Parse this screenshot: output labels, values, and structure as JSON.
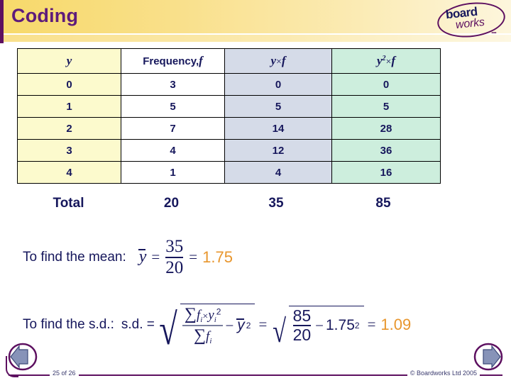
{
  "header": {
    "title": "Coding",
    "logo": {
      "primary": "board",
      "secondary": "works",
      "dots": "..."
    }
  },
  "table": {
    "columns": [
      {
        "key": "y",
        "label_main": "y",
        "label_sup": "",
        "label_op": "",
        "label_tail": ""
      },
      {
        "key": "f",
        "label_main": "Frequency,",
        "label_sup": "",
        "label_op": "",
        "label_tail": "f"
      },
      {
        "key": "yf",
        "label_main": "y",
        "label_sup": "",
        "label_op": "×",
        "label_tail": "f"
      },
      {
        "key": "y2f",
        "label_main": "y",
        "label_sup": "2",
        "label_op": "×",
        "label_tail": "f"
      }
    ],
    "rows": [
      {
        "y": "0",
        "f": "3",
        "yf": "0",
        "y2f": "0"
      },
      {
        "y": "1",
        "f": "5",
        "yf": "5",
        "y2f": "5"
      },
      {
        "y": "2",
        "f": "7",
        "yf": "14",
        "y2f": "28"
      },
      {
        "y": "3",
        "f": "4",
        "yf": "12",
        "y2f": "36"
      },
      {
        "y": "4",
        "f": "1",
        "yf": "4",
        "y2f": "16"
      }
    ],
    "totals": {
      "label": "Total",
      "f": "20",
      "yf": "35",
      "y2f": "85"
    },
    "colors": {
      "col_y": "#fcfacd",
      "col_f": "#ffffff",
      "col_yf": "#d5dbe8",
      "col_y2f": "#cdeedd",
      "text": "#16175c"
    }
  },
  "mean": {
    "prompt": "To find the mean:",
    "symbol": "y",
    "equals1": "=",
    "numerator": "35",
    "denominator": "20",
    "equals2": "=",
    "result": "1.75"
  },
  "sd": {
    "prompt": "To find the s.d.:",
    "label": "s.d. =",
    "sum_symbol": "∑",
    "num_f": "f",
    "num_sub": "i",
    "times": "×",
    "num_y": "y",
    "num_y_sub": "i",
    "num_y_sup": "2",
    "den_f": "f",
    "den_sub": "i",
    "minus": "−",
    "ybar": "y",
    "ybar_sup": "2",
    "equals1": "=",
    "numerator": "85",
    "denominator": "20",
    "minus2": "−",
    "mean_val": "1.75",
    "mean_sup": "2",
    "equals2": "=",
    "result": "1.09"
  },
  "footer": {
    "page": "25 of 26",
    "copyright": "© Boardworks Ltd 2005",
    "prev_label": "previous slide",
    "next_label": "next slide"
  },
  "accent": {
    "purple": "#5d1060",
    "title_purple": "#5e1b7b",
    "orange": "#e8962d",
    "navy": "#16175c"
  }
}
